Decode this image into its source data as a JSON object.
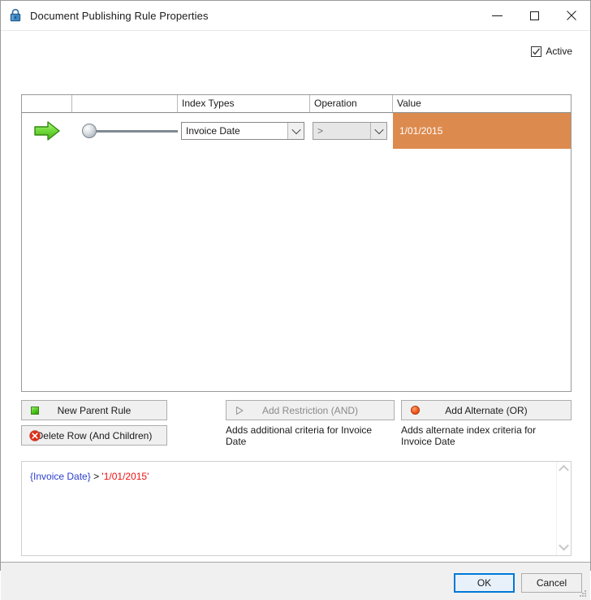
{
  "window": {
    "title": "Document Publishing Rule Properties",
    "icon": "lock-icon",
    "controls": {
      "minimize": "Minimize",
      "maximize": "Maximize",
      "close": "Close"
    }
  },
  "active": {
    "label": "Active",
    "checked": true
  },
  "grid": {
    "columns": [
      "",
      "",
      "Index Types",
      "Operation",
      "Value"
    ],
    "rows": [
      {
        "selector_icon": "green-arrow-icon",
        "node_icon": "node-circle-icon",
        "index_type": "Invoice Date",
        "operation": ">",
        "value": "1/01/2015",
        "value_color": "#dd8a4e"
      }
    ]
  },
  "actions": {
    "new_parent_rule": {
      "label": "New Parent Rule",
      "icon": "green-square-icon"
    },
    "delete_row": {
      "label": "Delete Row (And Children)",
      "icon": "red-x-circle-icon"
    },
    "add_restriction": {
      "label": "Add Restriction (AND)",
      "icon": "grey-triangle-icon",
      "hint": "Adds additional criteria for Invoice Date",
      "disabled": true
    },
    "add_alternate": {
      "label": "Add Alternate (OR)",
      "icon": "red-circle-icon",
      "hint": "Adds alternate index criteria for Invoice Date",
      "disabled": false
    }
  },
  "expression": {
    "field": "{Invoice Date}",
    "operator": ">",
    "value": "'1/01/2015'"
  },
  "footer": {
    "ok_label": "OK",
    "cancel_label": "Cancel"
  }
}
